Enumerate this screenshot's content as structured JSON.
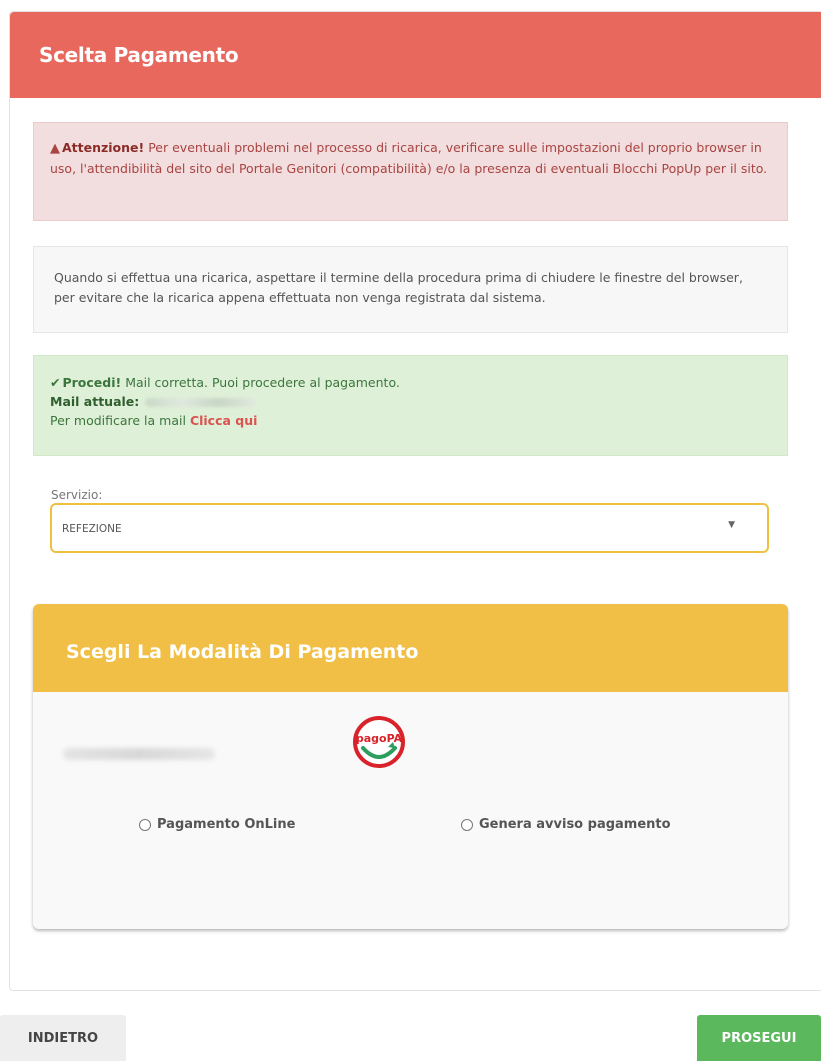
{
  "panel": {
    "title": "Scelta Pagamento"
  },
  "alerts": {
    "danger": {
      "icon": "warning-icon",
      "strong": "Attenzione!",
      "text": " Per eventuali problemi nel processo di ricarica, verificare sulle impostazioni del proprio browser in uso, l'attendibilità del sito del Portale Genitori (compatibilità) e/o la presenza di eventuali Blocchi PopUp per il sito."
    },
    "note": {
      "text": "Quando si effettua una ricarica, aspettare il termine della procedura prima di chiudere le finestre del browser, per evitare che la ricarica appena effettuata non venga registrata dal sistema."
    },
    "success": {
      "icon": "check-icon",
      "strong": "Procedi!",
      "text": " Mail corretta. Puoi procedere al pagamento.",
      "mail_label": "Mail attuale:",
      "modify_text": "Per modificare la mail ",
      "modify_link": "Clicca qui"
    }
  },
  "servizio": {
    "label": "Servizio:",
    "value": "REFEZIONE"
  },
  "payment": {
    "title": "Scegli La Modalità Di Pagamento",
    "logo_text": "pagoPA",
    "options": [
      "Pagamento OnLine",
      "Genera avviso pagamento"
    ]
  },
  "buttons": {
    "back": "INDIETRO",
    "next": "PROSEGUI"
  },
  "colors": {
    "header_red": "#e8685e",
    "payment_yellow": "#f2bf46",
    "success_green": "#5cb85c",
    "danger_text": "#a94442"
  }
}
